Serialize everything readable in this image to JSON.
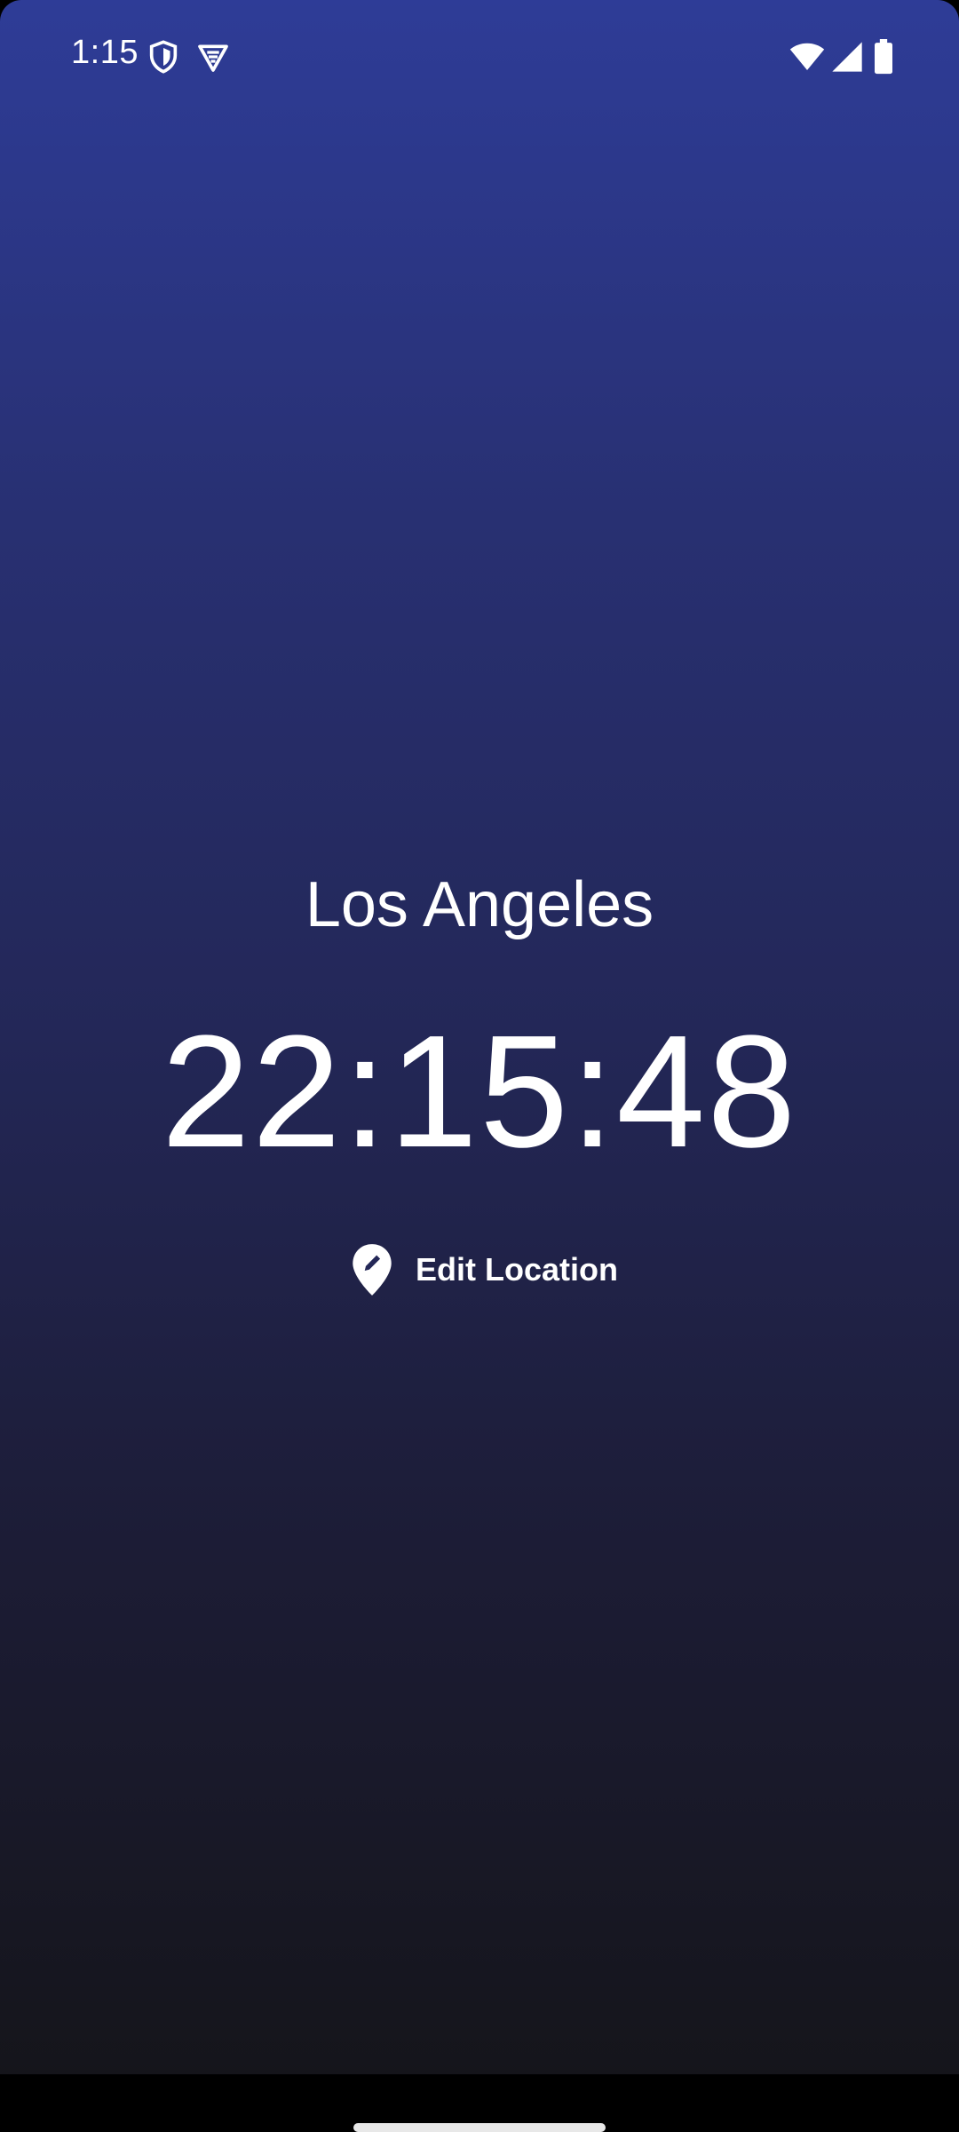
{
  "status_bar": {
    "time": "1:15",
    "icons": [
      "shield-icon",
      "vpn-icon",
      "wifi-icon",
      "cell-signal-icon",
      "battery-icon"
    ]
  },
  "main": {
    "city": "Los Angeles",
    "time": "22:15:48",
    "edit_button": {
      "icon": "edit-location-icon",
      "label": "Edit Location"
    }
  },
  "colors": {
    "gradient_top": "#2e3c97",
    "gradient_bottom": "#15151b",
    "text": "#ffffff"
  }
}
